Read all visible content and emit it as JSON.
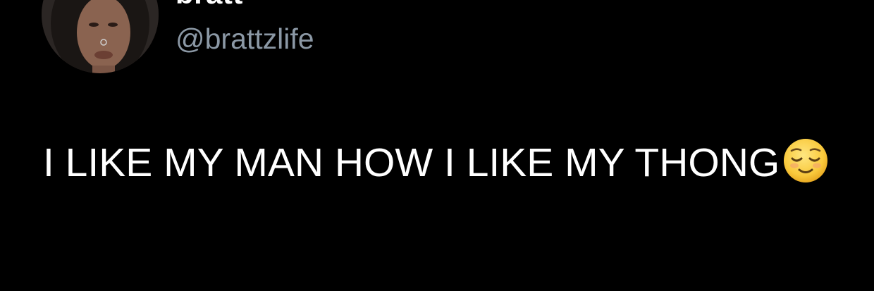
{
  "user": {
    "display_name": "bratt",
    "handle": "@brattzlife"
  },
  "tweet": {
    "text": "I LIKE MY MAN HOW I LIKE MY THONG",
    "emoji": "relieved-face-emoji"
  },
  "colors": {
    "background": "#000000",
    "text": "#ffffff",
    "handle": "#8b98a5"
  }
}
